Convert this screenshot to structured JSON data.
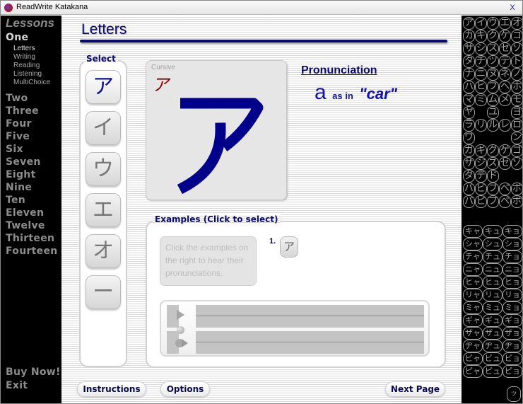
{
  "window": {
    "title": "ReadWrite Katakana",
    "close_label": "X"
  },
  "sidebar": {
    "heading": "Lessons",
    "lessons": [
      {
        "label": "One",
        "active": true
      },
      {
        "label": "Two"
      },
      {
        "label": "Three"
      },
      {
        "label": "Four"
      },
      {
        "label": "Five"
      },
      {
        "label": "Six"
      },
      {
        "label": "Seven"
      },
      {
        "label": "Eight"
      },
      {
        "label": "Nine"
      },
      {
        "label": "Ten"
      },
      {
        "label": "Eleven"
      },
      {
        "label": "Twelve"
      },
      {
        "label": "Thirteen"
      },
      {
        "label": "Fourteen"
      }
    ],
    "sub_items": [
      "Letters",
      "Writing",
      "Reading",
      "Listening",
      "MultiChoice"
    ],
    "active_sub": "Letters",
    "buy_now": "Buy Now!",
    "exit": "Exit"
  },
  "main": {
    "page_title": "Letters",
    "select": {
      "legend": "Select",
      "letters": [
        "ア",
        "イ",
        "ウ",
        "エ",
        "オ",
        "ー"
      ],
      "selected": "ア"
    },
    "character": {
      "cursive_label": "Cursive",
      "cursive_char": "ア",
      "char": "ア"
    },
    "pronunciation": {
      "heading": "Pronunciation",
      "letter": "a",
      "as_in": "as in",
      "word": "\"car\""
    },
    "examples": {
      "legend": "Examples (Click to select)",
      "hint": "Click the examples on the right to hear their pronunciations.",
      "items": [
        {
          "number": "1.",
          "char": "ア"
        }
      ]
    },
    "buttons": {
      "instructions": "Instructions",
      "options": "Options",
      "next_page": "Next Page"
    }
  },
  "kana_panel": {
    "basic_rows": [
      [
        "ア",
        "イ",
        "ウ",
        "エ",
        "オ"
      ],
      [
        "カ",
        "キ",
        "ク",
        "ケ",
        "コ"
      ],
      [
        "サ",
        "シ",
        "ス",
        "セ",
        "ソ"
      ],
      [
        "タ",
        "チ",
        "ツ",
        "テ",
        "ト"
      ],
      [
        "ナ",
        "ニ",
        "ヌ",
        "ネ",
        "ノ"
      ],
      [
        "ハ",
        "ヒ",
        "フ",
        "ヘ",
        "ホ"
      ],
      [
        "マ",
        "ミ",
        "ム",
        "メ",
        "モ"
      ],
      [
        "ヤ",
        "",
        "ユ",
        "",
        "ヨ"
      ],
      [
        "ラ",
        "リ",
        "ル",
        "レ",
        "ロ"
      ],
      [
        "ワ",
        "",
        "",
        "",
        "ン"
      ],
      [
        "ガ",
        "ギ",
        "グ",
        "ゲ",
        "ゴ"
      ],
      [
        "ザ",
        "ジ",
        "ズ",
        "ゼ",
        "ゾ"
      ],
      [
        "ダ",
        "デ",
        "ド",
        "",
        ""
      ],
      [
        "バ",
        "ビ",
        "ブ",
        "ベ",
        "ボ"
      ],
      [
        "パ",
        "ピ",
        "プ",
        "ペ",
        "ポ"
      ]
    ],
    "combo_rows": [
      [
        "キャ",
        "キュ",
        "キョ"
      ],
      [
        "シャ",
        "シュ",
        "ショ"
      ],
      [
        "チャ",
        "チュ",
        "チョ"
      ],
      [
        "ニャ",
        "ニュ",
        "ニョ"
      ],
      [
        "ヒャ",
        "ヒュ",
        "ヒョ"
      ],
      [
        "リャ",
        "リュ",
        "リョ"
      ],
      [
        "ミャ",
        "ミュ",
        "ミョ"
      ],
      [
        "ギャ",
        "ギュ",
        "ギョ"
      ],
      [
        "ザャ",
        "ザュ",
        "ザョ"
      ],
      [
        "ヂャ",
        "ヂュ",
        "ヂョ"
      ],
      [
        "ビャ",
        "ビュ",
        "ビョ"
      ],
      [
        "ピャ",
        "ピュ",
        "ピョ"
      ]
    ],
    "small_tsu": "ッ"
  }
}
